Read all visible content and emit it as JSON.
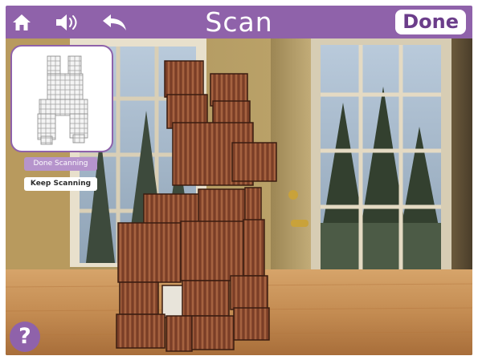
{
  "header": {
    "title": "Scan",
    "done_label": "Done",
    "icons": [
      "home-icon",
      "speaker-icon",
      "undo-icon"
    ]
  },
  "scan_panel": {
    "done_scanning_label": "Done Scanning",
    "keep_scanning_label": "Keep Scanning"
  },
  "help": {
    "label": "?"
  },
  "colors": {
    "accent": "#8f62aa",
    "accent_light": "#b694cc",
    "done_text": "#6b3d8a"
  }
}
